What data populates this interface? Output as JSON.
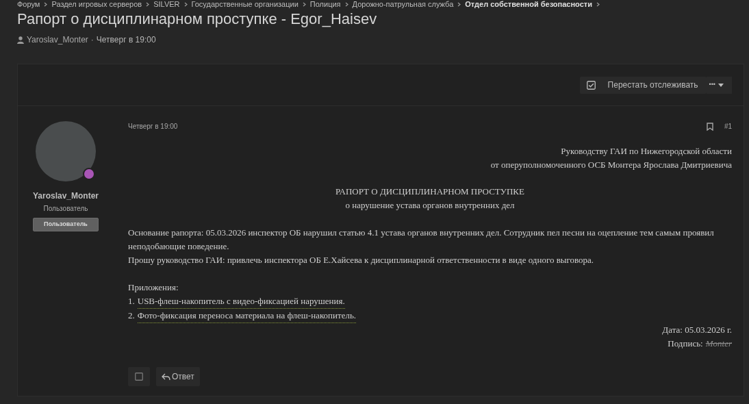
{
  "breadcrumbs": [
    {
      "label": "Форум",
      "current": false
    },
    {
      "label": "Раздел игровых серверов",
      "current": false
    },
    {
      "label": "SILVER",
      "current": false
    },
    {
      "label": "Государственные организации",
      "current": false
    },
    {
      "label": "Полиция",
      "current": false
    },
    {
      "label": "Дорожно-патрульная служба",
      "current": false
    },
    {
      "label": "Отдел собственной безопасности",
      "current": true
    }
  ],
  "thread": {
    "title": "Рапорт о дисциплинарном проступке - Egor_Haisev",
    "author": "Yaroslav_Monter",
    "separator": "·",
    "date": "Четверг в 19:00"
  },
  "toolbar": {
    "watch_button": "Перестать отслеживать",
    "watching": true,
    "more_button": "•••"
  },
  "post": {
    "author": {
      "name": "Yaroslav_Monter",
      "title": "Пользователь",
      "banner": "Пользователь",
      "color": "#a855b5"
    },
    "date": "Четверг в 19:00",
    "number": "#1",
    "addressee": [
      "Руководству ГАИ по Нижегородской области",
      "от оперуполномоченного ОСБ Монтера Ярослава Дмитриевича"
    ],
    "heading": "РАПОРТ О ДИСЦИПЛИНАРНОМ ПРОСТУПКЕ",
    "subheading": "о нарушение устава органов внутренних дел",
    "body": [
      "Основание рапорта: 05.03.2026 инспектор ОБ нарушил статью 4.1 устава органов внутренних дел. Сотрудник пел песни на оцепление тем самым проявил неподобающие поведение.",
      "Прошу руководство ГАИ: привлечь инспектора ОБ Е.Хайсева к дисциплинарной ответственности в виде одного выговора."
    ],
    "attachments_label": "Приложения:",
    "attachments": [
      {
        "number": "1.",
        "link": "USB-флеш-накопитель с видео-фиксацией нарушения."
      },
      {
        "number": "2.",
        "link": "Фото-фиксация переноса материала на флеш-накопитель."
      }
    ],
    "date_line": "Дата: 05.03.2026 г.",
    "signature_label": "Подпись:",
    "signature": "Monter",
    "select_checked": false,
    "reply_button": "Ответ"
  }
}
